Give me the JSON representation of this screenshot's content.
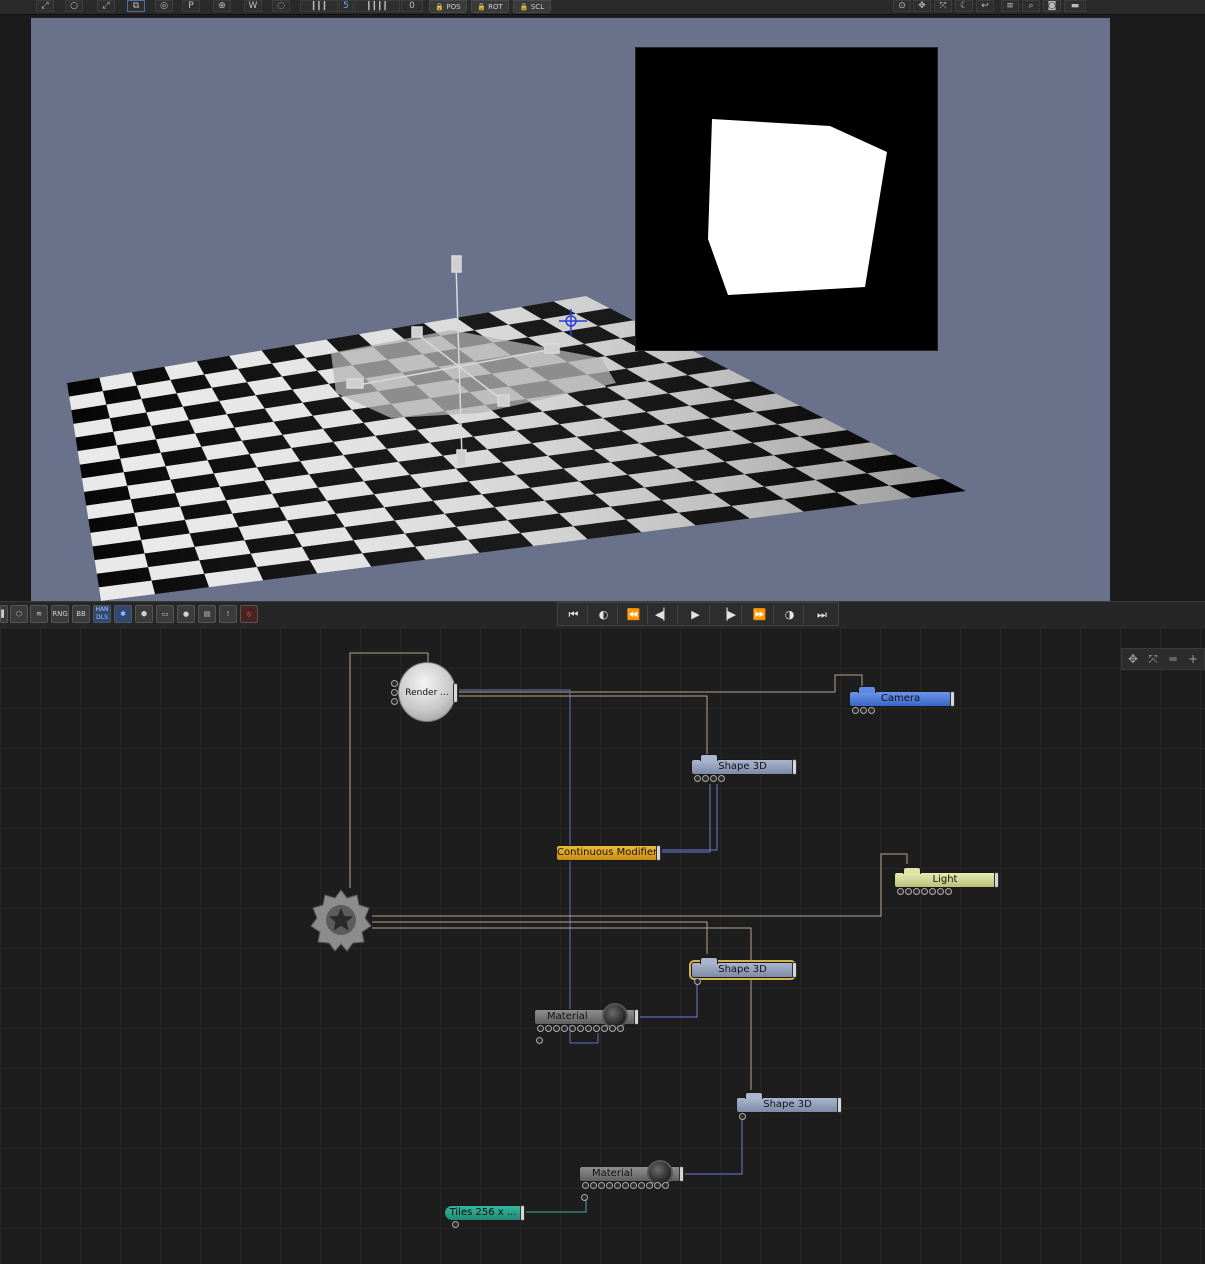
{
  "toolbar": {
    "number_5": "5",
    "number_0": "0",
    "lock_pos": "POS",
    "lock_rot": "ROT",
    "lock_scl": "SCL",
    "left_letters": {
      "p": "P",
      "w": "W"
    }
  },
  "transport_toolbar": {
    "tools": [
      "",
      "",
      "",
      "RNG",
      "BB",
      "HAN DLS",
      "✱",
      "",
      "",
      "",
      "",
      "!",
      "⦸"
    ]
  },
  "nodes": {
    "render": {
      "label": "Render ..."
    },
    "camera": {
      "label": "Camera"
    },
    "shape_top": {
      "label": "Shape 3D"
    },
    "modifier": {
      "label": "Continuous Modifier"
    },
    "light": {
      "label": "Light"
    },
    "shape_mid": {
      "label": "Shape 3D"
    },
    "material_top": {
      "label": "Material"
    },
    "shape_bottom": {
      "label": "Shape 3D"
    },
    "material_bottom": {
      "label": "Material"
    },
    "tiles": {
      "label": "Tiles 256 x ..."
    }
  },
  "colors": {
    "viewport_bg": "#6a718a",
    "camera_node": "#4a78d8",
    "light_node": "#d9e09a",
    "modifier_node": "#e3a622",
    "tiles_node": "#2aa78c",
    "shape_node": "#95a1bd",
    "selection": "#d2b44a"
  }
}
